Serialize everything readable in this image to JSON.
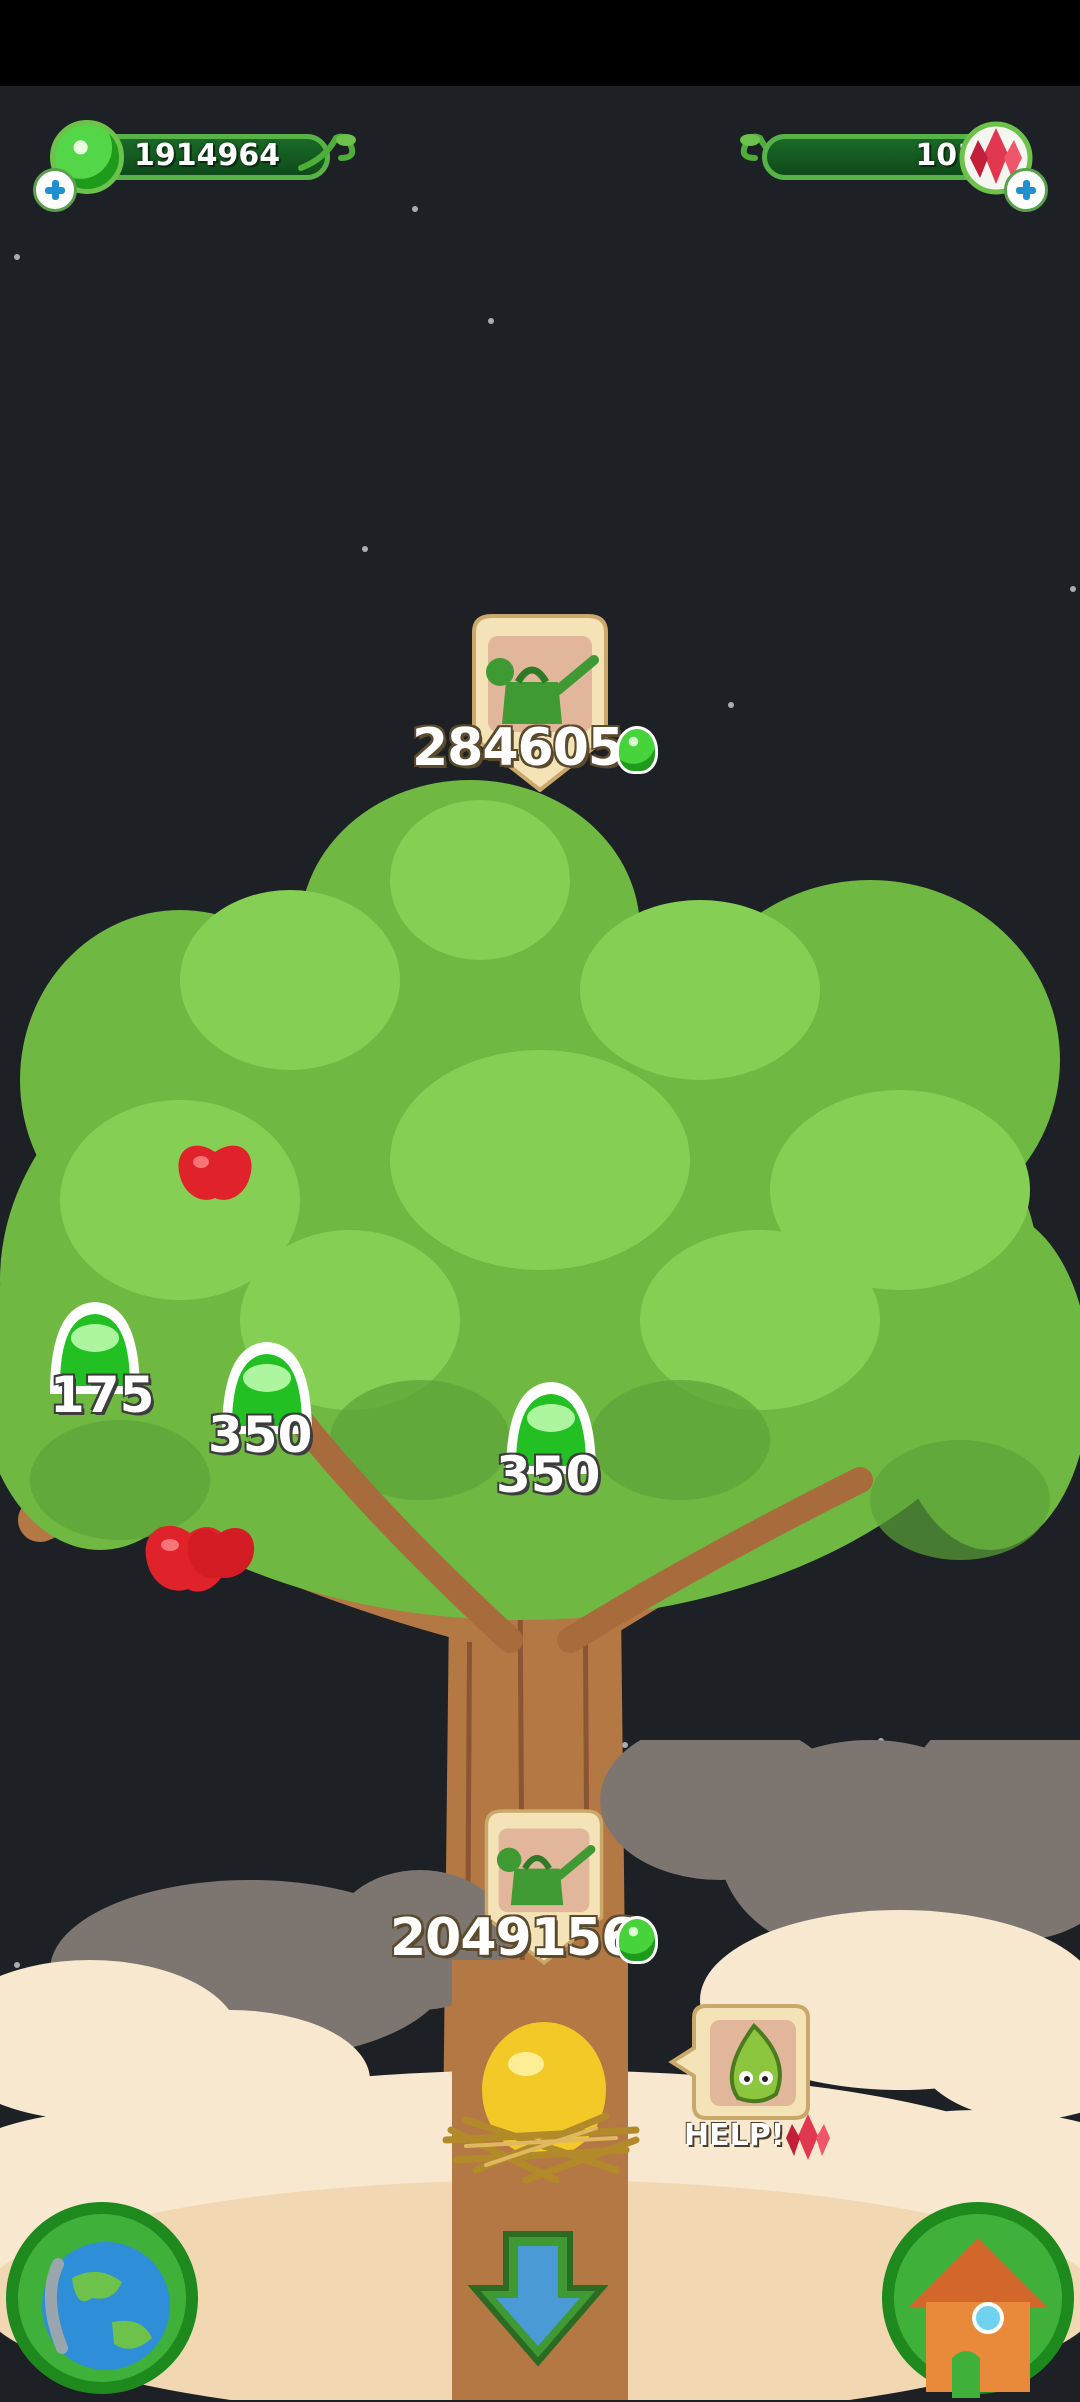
{
  "hud": {
    "left_value": "1914964",
    "right_value": "101"
  },
  "watering": {
    "top_value": "284605",
    "bottom_value": "2049156"
  },
  "fruits": [
    {
      "value": "175"
    },
    {
      "value": "350"
    },
    {
      "value": "350"
    }
  ],
  "helper": {
    "label": "HELP!"
  },
  "icons": {
    "currency": "green-gumdrop-icon",
    "premium": "red-crystal-icon",
    "add": "plus-icon",
    "watering": "watering-can-icon",
    "world": "globe-icon",
    "home": "house-icon",
    "scroll": "down-arrow-icon",
    "egg": "golden-egg-icon",
    "apple": "apple-icon"
  },
  "colors": {
    "sky": "#1d2126",
    "leaf": "#7cc34a",
    "trunk": "#b47845",
    "hud_green": "#57b347"
  }
}
